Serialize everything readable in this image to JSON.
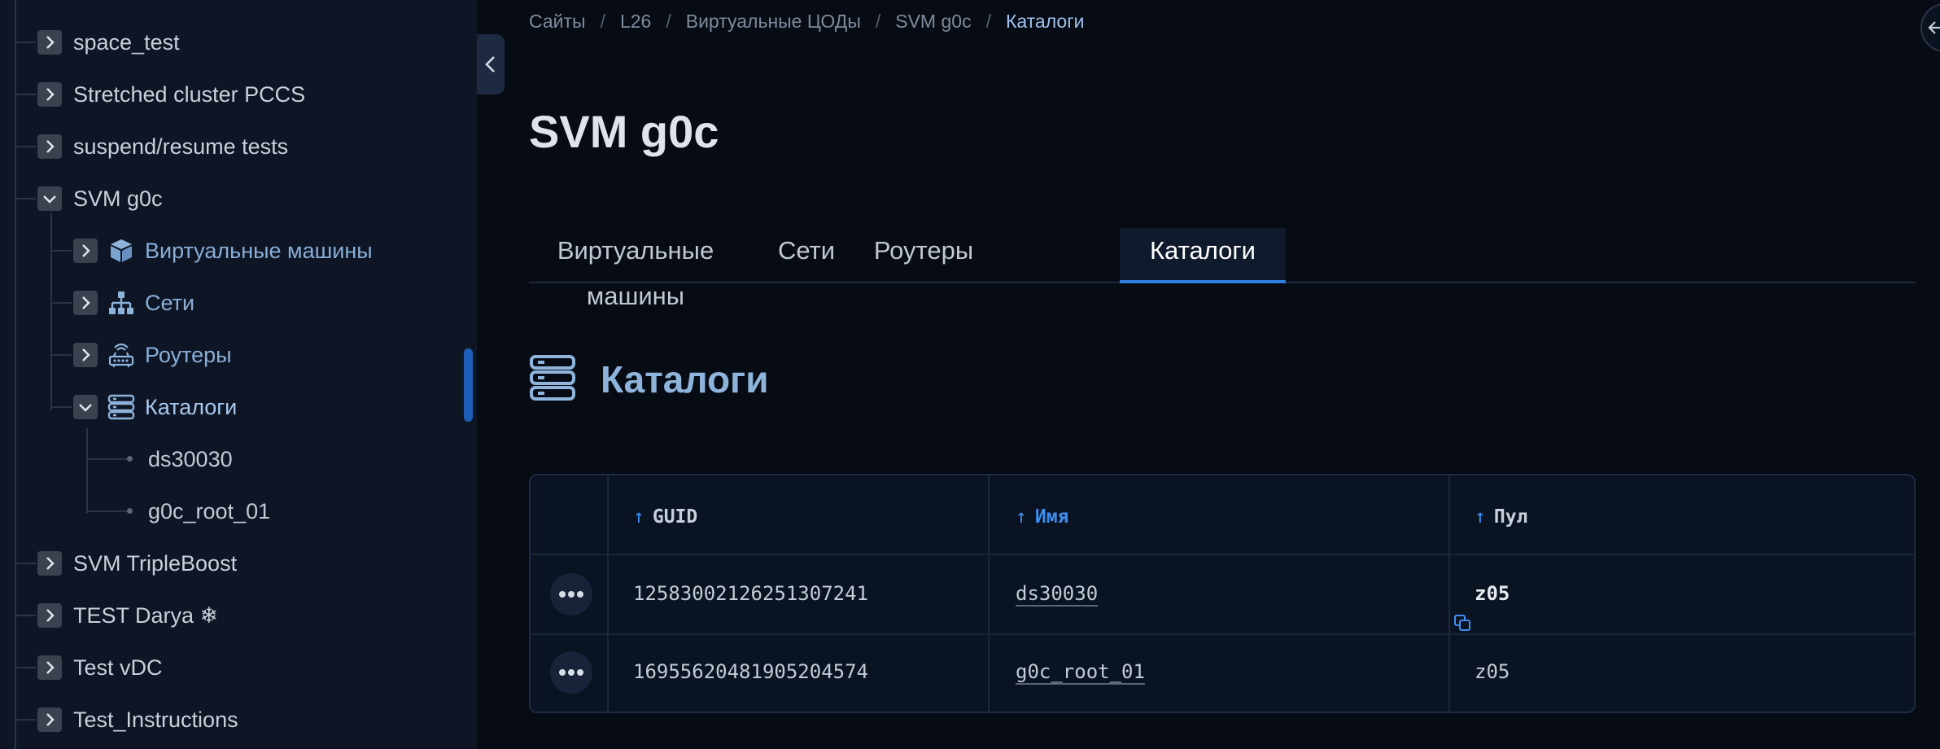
{
  "sidebar": {
    "items": [
      {
        "label": "space_test",
        "expanded": false
      },
      {
        "label": "Stretched cluster PCCS",
        "expanded": false
      },
      {
        "label": "suspend/resume tests",
        "expanded": false
      },
      {
        "label": "SVM g0c",
        "expanded": true,
        "children": [
          {
            "label": "Виртуальные машины",
            "icon": "cube-icon",
            "expanded": false
          },
          {
            "label": "Сети",
            "icon": "network-icon",
            "expanded": false
          },
          {
            "label": "Роутеры",
            "icon": "router-icon",
            "expanded": false
          },
          {
            "label": "Каталоги",
            "icon": "catalog-icon",
            "expanded": true,
            "children": [
              {
                "label": "ds30030"
              },
              {
                "label": "g0c_root_01"
              }
            ]
          }
        ]
      },
      {
        "label": "SVM TripleBoost",
        "expanded": false
      },
      {
        "label": "TEST Darya ❄",
        "expanded": false
      },
      {
        "label": "Test vDC",
        "expanded": false
      },
      {
        "label": "Test_Instructions",
        "expanded": false
      }
    ]
  },
  "breadcrumb": {
    "items": [
      "Сайты",
      "L26",
      "Виртуальные ЦОДы",
      "SVM g0c"
    ],
    "current": "Каталоги",
    "separator": "/"
  },
  "page": {
    "title": "SVM g0c"
  },
  "tabs": {
    "items": [
      "Виртуальные машины",
      "Сети",
      "Роутеры",
      "Каталоги"
    ],
    "active_index": 3
  },
  "section": {
    "title": "Каталоги",
    "icon": "catalog-icon"
  },
  "table": {
    "columns": [
      {
        "label": "GUID",
        "sort": "asc",
        "highlighted": false
      },
      {
        "label": "Имя",
        "sort": "asc",
        "highlighted": true
      },
      {
        "label": "Пул",
        "sort": "asc",
        "highlighted": false
      }
    ],
    "sort_arrow": "↑",
    "rows": [
      {
        "guid": "12583002126251307241",
        "name": "ds30030",
        "pool": "z05"
      },
      {
        "guid": "16955620481905204574",
        "name": "g0c_root_01",
        "pool": "z05"
      }
    ]
  },
  "colors": {
    "accent": "#2f7ee0",
    "sidebar_bg": "#0e1626",
    "main_bg": "#060b14",
    "link": "#8aaed6"
  }
}
